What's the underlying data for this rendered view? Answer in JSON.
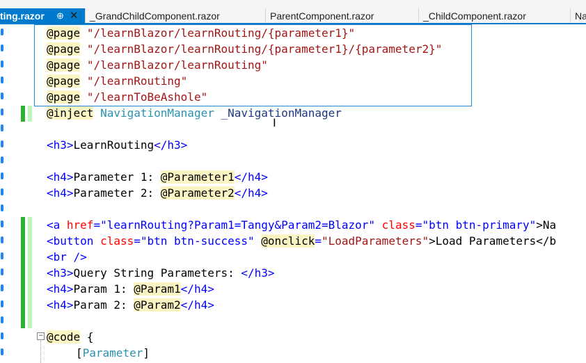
{
  "tabs": [
    {
      "label": "ting.razor",
      "pin": "⊕",
      "close": "✕"
    },
    {
      "label": "_GrandChildComponent.razor"
    },
    {
      "label": "ParentComponent.razor"
    },
    {
      "label": "_ChildComponent.razor"
    },
    {
      "label": "Na"
    }
  ],
  "popup_lines": [
    {
      "directive": "@page",
      "value": "\"/learnBlazor/learnRouting/{parameter1}\""
    },
    {
      "directive": "@page",
      "value": "\"/learnBlazor/learnRouting/{parameter1}/{parameter2}\""
    },
    {
      "directive": "@page",
      "value": "\"/learnBlazor/learnRouting\""
    },
    {
      "directive": "@page",
      "value": "\"/learnRouting\""
    },
    {
      "directive": "@page",
      "value": "\"/learnToBeAshole\""
    }
  ],
  "code": {
    "inject": {
      "directive": "@inject",
      "type": "NavigationManager",
      "name": "_NavigationManager"
    },
    "h3_learn": {
      "open": "<h3>",
      "text": "LearnRouting",
      "close": "</h3>"
    },
    "h4_p1": {
      "open": "<h4>",
      "text": "Parameter 1: ",
      "expr": "@Parameter1",
      "close": "</h4>"
    },
    "h4_p2": {
      "open": "<h4>",
      "text": "Parameter 2: ",
      "expr": "@Parameter2",
      "close": "</h4>"
    },
    "anchor": {
      "open": "<a ",
      "href_attr": "href",
      "eq": "=",
      "href_val": "\"learnRouting?Param1=Tangy&Param2=Blazor\"",
      "class_attr": "class",
      "class_val": "\"btn btn-primary\"",
      "end": ">Na"
    },
    "button": {
      "open": "<button ",
      "class_attr": "class",
      "class_val": "\"btn btn-success\"",
      "onclick_attr": "@onclick",
      "onclick_val": "\"LoadParameters\"",
      "end": ">Load Parameters</b"
    },
    "br": "<br />",
    "h3_qs": {
      "open": "<h3>",
      "text": "Query String Parameters: ",
      "close": "</h3>"
    },
    "h4_param1": {
      "open": "<h4>",
      "text": "Param 1: ",
      "expr": "@Param1",
      "close": "</h4>"
    },
    "h4_param2": {
      "open": "<h4>",
      "text": "Param 2: ",
      "expr": "@Param2",
      "close": "</h4>"
    },
    "code_block": {
      "directive": "@code",
      "brace": " {"
    },
    "parameter_attr": {
      "open": "[",
      "name": "Parameter",
      "close": "]"
    },
    "collapse_glyph": "−",
    "cursor_glyph": "I"
  }
}
